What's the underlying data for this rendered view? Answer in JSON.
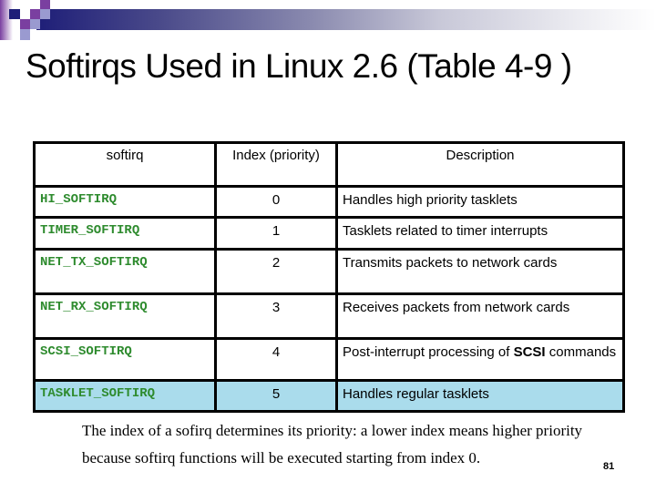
{
  "slide": {
    "title": "Softirqs Used in Linux 2.6 (Table 4-9 )",
    "page_number": "81",
    "accent_colors": {
      "dark_blue": "#1e1e78",
      "purple": "#7a3fa0",
      "lavender": "#9a9ad0",
      "softirq_name_green": "#2e8b2e",
      "highlight_row": "#aadcec"
    }
  },
  "table": {
    "headers": [
      "softirq",
      "Index (priority)",
      "Description"
    ],
    "rows": [
      {
        "name": "HI_SOFTIRQ",
        "index": "0",
        "description": "Handles high priority tasklets"
      },
      {
        "name": "TIMER_SOFTIRQ",
        "index": "1",
        "description": "Tasklets related to timer interrupts"
      },
      {
        "name": "NET_TX_SOFTIRQ",
        "index": "2",
        "description": "Transmits packets to network cards"
      },
      {
        "name": "NET_RX_SOFTIRQ",
        "index": "3",
        "description": "Receives packets from network cards"
      },
      {
        "name": "SCSI_SOFTIRQ",
        "index": "4",
        "description_prefix": "Post-interrupt processing of ",
        "description_bold": "SCSI",
        "description_suffix": " commands"
      },
      {
        "name": "TASKLET_SOFTIRQ",
        "index": "5",
        "description": "Handles regular tasklets"
      }
    ]
  },
  "note": {
    "line1": "The index of a sofirq determines its priority: a lower index means higher priority",
    "line2": "because softirq functions will be executed starting from index 0."
  }
}
